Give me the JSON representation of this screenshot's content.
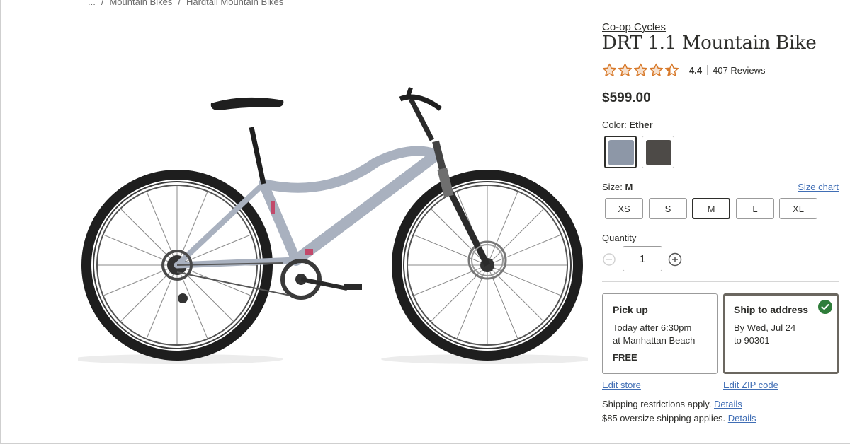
{
  "breadcrumb": {
    "items": [
      "...",
      "Mountain Bikes",
      "Hardtail Mountain Bikes"
    ],
    "separator": "/"
  },
  "product": {
    "brand": "Co-op Cycles",
    "title": "DRT 1.1 Mountain Bike",
    "rating": {
      "value": "4.4",
      "stars_filled": 4.4,
      "stars_total": 5,
      "review_count": "407",
      "review_label": "Reviews"
    },
    "price": "$599.00",
    "image_icon": "mountain-bike-image"
  },
  "color": {
    "label": "Color:",
    "selected": "Ether",
    "swatches": [
      {
        "name": "Ether",
        "hex": "#8d97a7",
        "selected": true
      },
      {
        "name": "Dark",
        "hex": "#4d4a47",
        "selected": false
      }
    ]
  },
  "size": {
    "label": "Size:",
    "selected": "M",
    "chart_link": "Size chart",
    "options": [
      "XS",
      "S",
      "M",
      "L",
      "XL"
    ]
  },
  "quantity": {
    "label": "Quantity",
    "value": "1",
    "minus_icon": "minus-circle-icon",
    "plus_icon": "plus-circle-icon"
  },
  "fulfillment": {
    "pickup": {
      "title": "Pick up",
      "line1": "Today after 6:30pm",
      "line2": "at Manhattan Beach",
      "price": "FREE",
      "edit_link": "Edit store"
    },
    "ship": {
      "title": "Ship to address",
      "line1": "By Wed, Jul 24",
      "line2": "to 90301",
      "edit_link": "Edit ZIP code",
      "selected": true
    }
  },
  "shipping_notes": [
    {
      "text": "Shipping restrictions apply.",
      "link": "Details"
    },
    {
      "text": "$85 oversize shipping applies.",
      "link": "Details"
    }
  ],
  "colors": {
    "text": "#2e2e2b",
    "link": "#406eb5",
    "star": "#d87a2b",
    "check": "#2f7d3a"
  }
}
